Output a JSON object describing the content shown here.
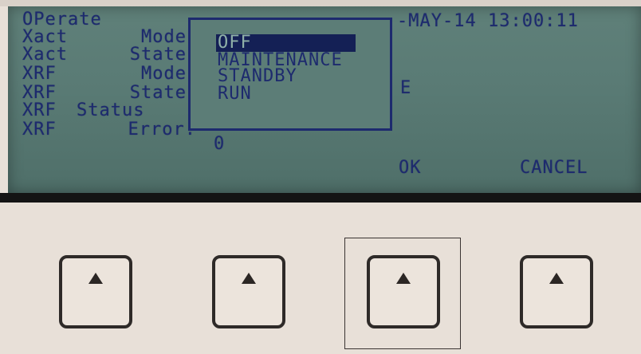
{
  "screen": {
    "left_labels": [
      {
        "label": "OPerate"
      },
      {
        "label": "Xact",
        "field": "Mode"
      },
      {
        "label": "Xact",
        "field": "State"
      },
      {
        "label": "XRF",
        "field": "Mode"
      },
      {
        "label": "XRF",
        "field": "State"
      },
      {
        "label": "XRF",
        "field": "Status"
      },
      {
        "label": "XRF",
        "field": "Error:"
      }
    ],
    "datetime": "-MAY-14 13:00:11",
    "xrf_mode_value": "E",
    "xrf_error_value": "0",
    "softkeys": {
      "ok": "OK",
      "cancel": "CANCEL"
    }
  },
  "dialog": {
    "options": [
      "OFF",
      "MAINTENANCE",
      "STANDBY",
      "RUN"
    ],
    "selected": "OFF"
  },
  "keypad": {
    "keys": [
      "up-arrow",
      "up-arrow",
      "up-arrow",
      "up-arrow"
    ],
    "highlighted_index": 2
  },
  "colors": {
    "lcd_background": "#5a7b75",
    "lcd_text": "#1d2a6e",
    "panel": "#e8e0d8"
  }
}
